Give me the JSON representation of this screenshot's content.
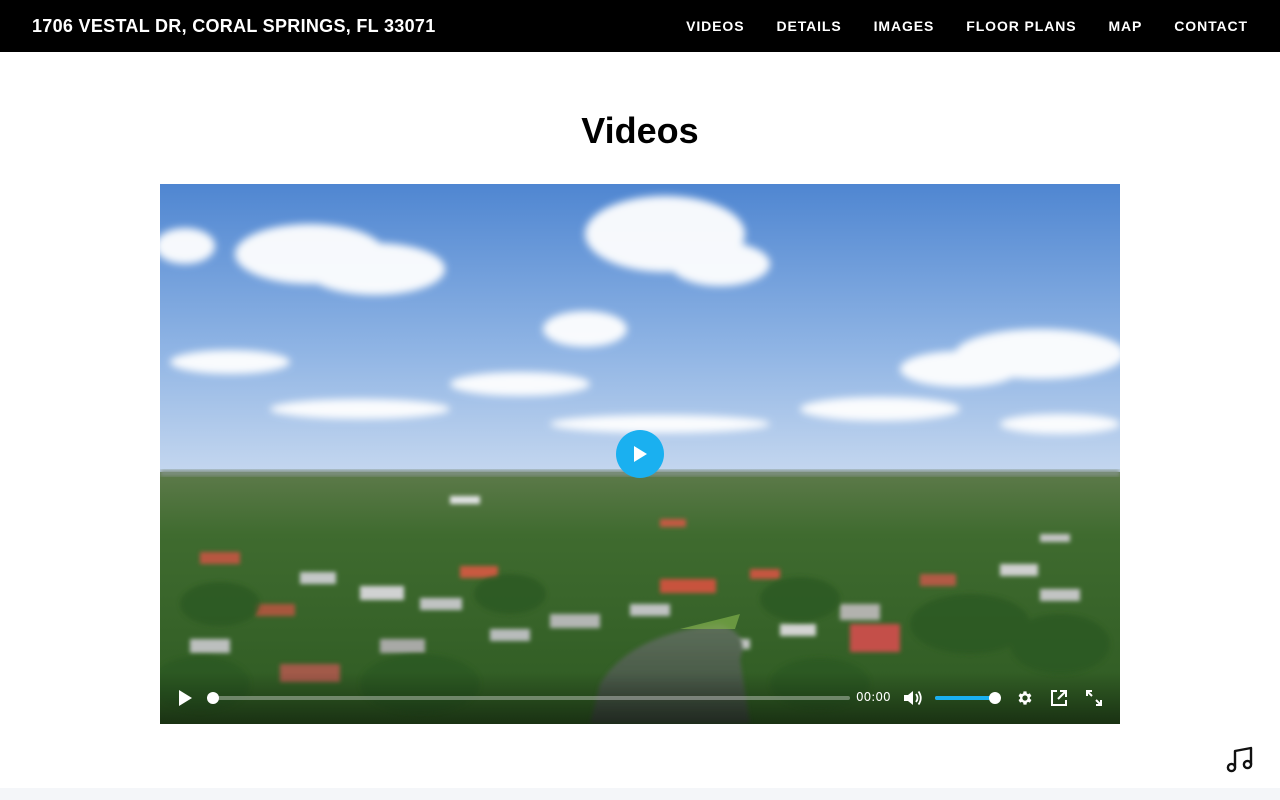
{
  "header": {
    "title": "1706 VESTAL DR, CORAL SPRINGS, FL 33071",
    "nav": [
      {
        "label": "VIDEOS"
      },
      {
        "label": "DETAILS"
      },
      {
        "label": "IMAGES"
      },
      {
        "label": "FLOOR PLANS"
      },
      {
        "label": "MAP"
      },
      {
        "label": "CONTACT"
      }
    ]
  },
  "main": {
    "section_title": "Videos"
  },
  "player": {
    "time": "00:00",
    "progress": 0,
    "volume": 1.0,
    "accent_color": "#1ab0f0",
    "icons": [
      "play-icon",
      "volume-icon",
      "settings-icon",
      "popout-icon",
      "fullscreen-icon"
    ]
  },
  "floating": {
    "icon": "music-note-icon"
  },
  "colors": {
    "header_bg": "#000000",
    "accent": "#1ab0f0"
  }
}
